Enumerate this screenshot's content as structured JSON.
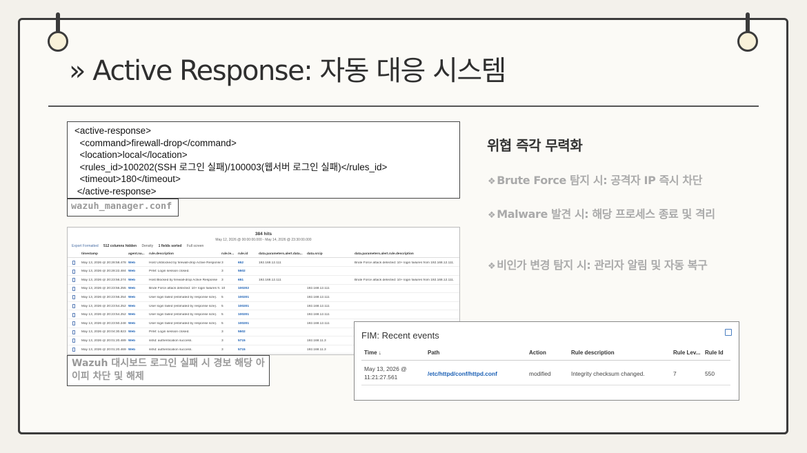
{
  "slide": {
    "title": "» Active Response: 자동 대응 시스템"
  },
  "code": {
    "lines": [
      "<active-response>",
      "  <command>firewall-drop</command>",
      "  <location>local</location>",
      "  <rules_id>100202(SSH 로그인 실패)/100003(웹서버 로그인 실패)</rules_id>",
      "  <timeout>180</timeout>",
      " </active-response>"
    ],
    "caption": "wazuh_manager.conf"
  },
  "dashboard": {
    "hits": "384 hits",
    "range": "May 12, 2026 @ 00:00:00.000 - May 14, 2026 @ 23:30:00.000",
    "toolbar": [
      "Export Formatted",
      "512 columns hidden",
      "Density",
      "1 fields sorted",
      "Full screen"
    ],
    "columns": [
      "timestamp",
      "agent.na...",
      "rule.description",
      "rule.le...",
      "rule.id",
      "data.parameters.alert.data...",
      "data.srcip",
      "data.parameters.alert.rule.description"
    ],
    "rows": [
      [
        "May 13, 2026 @ 20:28:58.478",
        "Web",
        "Host Unblocked by firewall-drop Active Response",
        "3",
        "652",
        "192.168.12.111",
        "",
        "Brute Force attack detected: 10+ login failures from 192.168.12.111."
      ],
      [
        "May 13, 2026 @ 20:28:22.484",
        "Web",
        "PAM: Login session closed.",
        "3",
        "5502",
        "",
        "",
        ""
      ],
      [
        "May 13, 2026 @ 20:23:56.274",
        "Web",
        "Host Blocked by firewall-drop Active Response",
        "3",
        "651",
        "192.168.12.111",
        "",
        "Brute Force attack detected: 10+ login failures from 192.168.12.111."
      ],
      [
        "May 13, 2026 @ 20:23:56.255",
        "Web",
        "Brute Force attack detected: 10+ login failures fr...",
        "10",
        "100202",
        "",
        "192.168.12.111",
        ""
      ],
      [
        "May 13, 2026 @ 20:23:56.254",
        "Web",
        "User login failed (estimated by response size).",
        "5",
        "100201",
        "",
        "192.168.12.111",
        ""
      ],
      [
        "May 13, 2026 @ 20:23:54.252",
        "Web",
        "User login failed (estimated by response size).",
        "5",
        "100201",
        "",
        "192.168.12.111",
        ""
      ],
      [
        "May 13, 2026 @ 20:23:54.252",
        "Web",
        "User login failed (estimated by response size).",
        "5",
        "100201",
        "",
        "192.168.12.111",
        ""
      ],
      [
        "May 13, 2026 @ 20:23:50.248",
        "Web",
        "User login failed (estimated by response size).",
        "5",
        "100201",
        "",
        "192.168.12.111",
        ""
      ],
      [
        "May 13, 2026 @ 20:04:30.823",
        "Web",
        "PAM: Login session closed.",
        "3",
        "5502",
        "",
        "",
        ""
      ],
      [
        "May 13, 2026 @ 20:01:20.489",
        "Web",
        "sshd: authentication success.",
        "3",
        "5715",
        "",
        "192.168.11.3",
        ""
      ],
      [
        "May 13, 2026 @ 20:01:20.469",
        "Web",
        "sshd: authentication success.",
        "3",
        "5715",
        "",
        "192.168.11.3",
        ""
      ]
    ],
    "caption": "Wazuh 대시보드 로그인 실패 시 경보 해당 아이피 차단 및 해제"
  },
  "fim": {
    "title": "FIM: Recent events",
    "columns": [
      "Time ↓",
      "Path",
      "Action",
      "Rule description",
      "Rule Lev...",
      "Rule Id"
    ],
    "row": {
      "time": "May 13, 2026 @ 11:21:27.561",
      "path": "/etc/httpd/conf/httpd.conf",
      "action": "modified",
      "description": "Integrity checksum changed.",
      "level": "7",
      "id": "550"
    }
  },
  "sidebar": {
    "heading": "위협 즉각 무력화",
    "bullet_mark": "❖",
    "bullets": [
      "Brute Force 탐지 시: 공격자 IP 즉시 차단",
      "Malware 발견 시: 해당 프로세스 종료 및 격리",
      "비인가 변경 탐지 시: 관리자 알림 및 자동 복구"
    ]
  }
}
